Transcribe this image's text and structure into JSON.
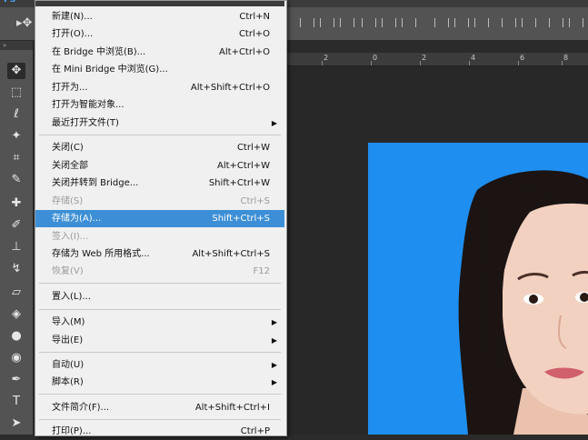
{
  "app": {
    "logo": "Ps"
  },
  "file_menu": {
    "items": [
      {
        "label": "新建(N)...",
        "shortcut": "Ctrl+N"
      },
      {
        "label": "打开(O)...",
        "shortcut": "Ctrl+O"
      },
      {
        "label": "在 Bridge 中浏览(B)...",
        "shortcut": "Alt+Ctrl+O"
      },
      {
        "label": "在 Mini Bridge 中浏览(G)...",
        "shortcut": ""
      },
      {
        "label": "打开为...",
        "shortcut": "Alt+Shift+Ctrl+O"
      },
      {
        "label": "打开为智能对象...",
        "shortcut": ""
      },
      {
        "label": "最近打开文件(T)",
        "shortcut": ""
      },
      {
        "label": "关闭(C)",
        "shortcut": "Ctrl+W"
      },
      {
        "label": "关闭全部",
        "shortcut": "Alt+Ctrl+W"
      },
      {
        "label": "关闭并转到 Bridge...",
        "shortcut": "Shift+Ctrl+W"
      },
      {
        "label": "存储(S)",
        "shortcut": "Ctrl+S"
      },
      {
        "label": "存储为(A)...",
        "shortcut": "Shift+Ctrl+S"
      },
      {
        "label": "签入(I)...",
        "shortcut": ""
      },
      {
        "label": "存储为 Web 所用格式...",
        "shortcut": "Alt+Shift+Ctrl+S"
      },
      {
        "label": "恢复(V)",
        "shortcut": "F12"
      },
      {
        "label": "置入(L)...",
        "shortcut": ""
      },
      {
        "label": "导入(M)",
        "shortcut": ""
      },
      {
        "label": "导出(E)",
        "shortcut": ""
      },
      {
        "label": "自动(U)",
        "shortcut": ""
      },
      {
        "label": "脚本(R)",
        "shortcut": ""
      },
      {
        "label": "文件简介(F)...",
        "shortcut": "Alt+Shift+Ctrl+I"
      },
      {
        "label": "打印(P)...",
        "shortcut": "Ctrl+P"
      }
    ],
    "highlighted": "存储为(A)...",
    "highlight_color": "#3c8fd6"
  },
  "ruler": {
    "ticks": [
      "2",
      "0",
      "2",
      "4",
      "6",
      "8"
    ]
  },
  "photo": {
    "background_color": "#1e8ef0"
  }
}
